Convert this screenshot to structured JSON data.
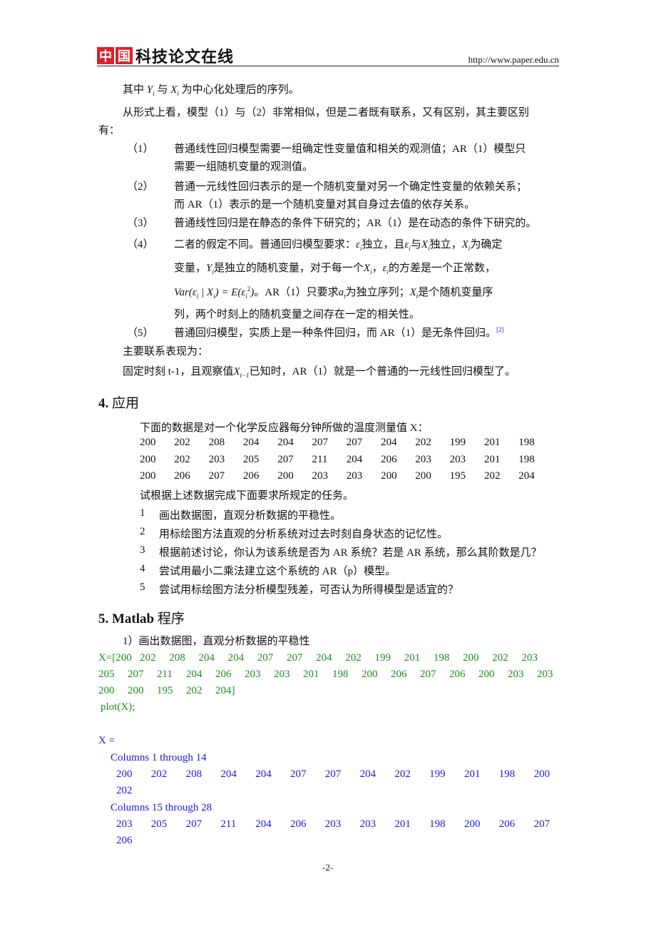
{
  "header": {
    "logo_red_chars": [
      "中",
      "国"
    ],
    "logo_text": "科技论文在线",
    "url": "http://www.paper.edu.cn",
    "logo_color": "#d8232a"
  },
  "para_intro": {
    "pre": "其中",
    "y": "Y",
    "sub_i": "i",
    "mid": "与",
    "x": "X",
    "post": "为中心化处理后的序列。"
  },
  "para_compare_1": "从形式上看，模型（1）与（2）非常相似，但是二者既有联系，又有区别，其主要区别",
  "para_compare_2": "有：",
  "differences": [
    {
      "num": "（1）",
      "lines": [
        "普通线性回归模型需要一组确定性变量值和相关的观测值；AR（1）模型只",
        "需要一组随机变量的观测值。"
      ]
    },
    {
      "num": "（2）",
      "lines": [
        "普通一元线性回归表示的是一个随机变量对另一个确定性变量的依赖关系；",
        "而 AR（1）表示的是一个随机变量对其自身过去值的依存关系。"
      ]
    },
    {
      "num": "（3）",
      "lines": [
        "普通线性回归是在静态的条件下研究的；AR（1）是在动态的条件下研究的。"
      ]
    },
    {
      "num": "（4）",
      "line1": {
        "a": "二者的假定不同。普通回归模型要求：",
        "b": "独立，且",
        "c": "与",
        "d": "独立，",
        "e": "为确定"
      },
      "line2": {
        "a": "变量，",
        "b": "是独立的随机变量，对于每一个",
        "c": "，",
        "d": "的方差是一个正常数，"
      },
      "line3": {
        "formula_a": "Var(ε",
        "formula_b": " | X",
        "formula_c": ") = E(ε",
        "formula_d": ")",
        "a": "。AR（1）只要求",
        "b": "为独立序列；",
        "c": "是个随机变量序"
      },
      "line4": "列，两个时刻上的随机变量之间存在一定的相关性。",
      "sym_eps": "ε",
      "sym_x": "X",
      "sym_y": "Y",
      "sym_a": "a",
      "sub_i": "i",
      "sub_t": "t",
      "sup_2": "2"
    },
    {
      "num": "（5）",
      "lines": [
        "普通回归模型，实质上是一种条件回归，而 AR（1）是无条件回归。"
      ],
      "ref": "[2]"
    }
  ],
  "relation_title": "主要联系表现为：",
  "relation": {
    "a": "固定时刻 t-1，且观察值",
    "x": "X",
    "sub": "t−1",
    "b": "已知时，AR（1）就是一个普通的一元线性回归模型了。"
  },
  "section4": {
    "num": "4.",
    "title": "应用",
    "intro": "下面的数据是对一个化学反应器每分钟所做的温度测量值 X：",
    "data_rows": [
      [
        "200",
        "202",
        "208",
        "204",
        "204",
        "207",
        "207",
        "204",
        "202",
        "199",
        "201",
        "198"
      ],
      [
        "200",
        "202",
        "203",
        "205",
        "207",
        "211",
        "204",
        "206",
        "203",
        "203",
        "201",
        "198"
      ],
      [
        "200",
        "206",
        "207",
        "206",
        "200",
        "203",
        "203",
        "200",
        "200",
        "195",
        "202",
        "204"
      ]
    ],
    "task_intro": "试根据上述数据完成下面要求所规定的任务。",
    "tasks": [
      {
        "n": "1",
        "text": "画出数据图，直观分析数据的平稳性。"
      },
      {
        "n": "2",
        "text": "用标绘图方法直观的分析系统对过去时刻自身状态的记忆性。"
      },
      {
        "n": "3",
        "text": "根据前述讨论，你认为该系统是否为 AR 系统？若是 AR 系统，那么其阶数是几？"
      },
      {
        "n": "4",
        "text": "尝试用最小二乘法建立这个系统的 AR（p）模型。"
      },
      {
        "n": "5",
        "text": "尝试用标绘图方法分析模型残差，可否认为所得模型是适宜的？"
      }
    ]
  },
  "section5": {
    "num": "5.",
    "title_en": "Matlab",
    "title_cn": "程序",
    "step1": "1）画出数据图，直观分析数据的平稳性",
    "code_lines": [
      [
        "X=[200",
        "202",
        "208",
        "204",
        "204",
        "207",
        "207",
        "204",
        "202",
        "199",
        "201",
        "198",
        "200",
        "202",
        "203"
      ],
      [
        "205",
        "207",
        "211",
        "204",
        "206",
        "203",
        "203",
        "201",
        "198",
        "200",
        "206",
        "207",
        "206",
        "200",
        "203",
        "203"
      ],
      [
        "200",
        "200",
        "195",
        "202",
        "204]"
      ]
    ],
    "code_plot": "plot(X);",
    "code_color": "#1f8a1f",
    "output_color": "#1a1ae6",
    "output": {
      "var": "X =",
      "blocks": [
        {
          "label": "Columns 1 through 14",
          "row": [
            "200",
            "202",
            "208",
            "204",
            "204",
            "207",
            "207",
            "204",
            "202",
            "199",
            "201",
            "198",
            "200"
          ],
          "wrap": "202"
        },
        {
          "label": "Columns 15 through 28",
          "row": [
            "203",
            "205",
            "207",
            "211",
            "204",
            "206",
            "203",
            "203",
            "201",
            "198",
            "200",
            "206",
            "207"
          ],
          "wrap": "206"
        }
      ]
    }
  },
  "footer": {
    "page": "-2-"
  }
}
